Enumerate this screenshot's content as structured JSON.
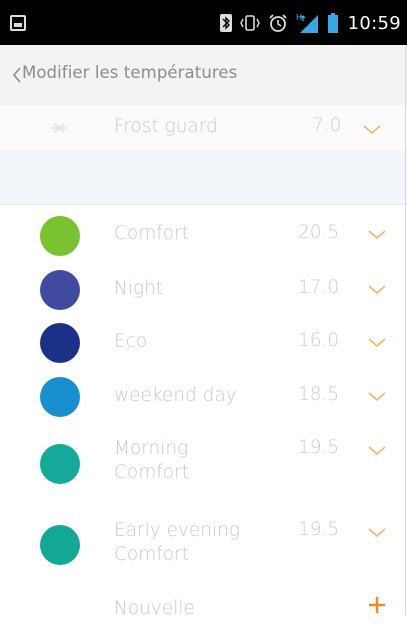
{
  "statusbar": {
    "time": "10:59",
    "icons": [
      "image-icon",
      "bluetooth-icon",
      "vibrate-icon",
      "alarm-icon",
      "signal-icon",
      "battery-icon"
    ]
  },
  "header": {
    "title": "Modifier les températures"
  },
  "frost": {
    "label": "Frost guard",
    "value": "7.0"
  },
  "items": [
    {
      "label": "Comfort",
      "value": "20.5",
      "color": "#7ac231"
    },
    {
      "label": "Night",
      "value": "17.0",
      "color": "#3f4aa0"
    },
    {
      "label": "Eco",
      "value": "16.0",
      "color": "#1d3087"
    },
    {
      "label": "weekend day",
      "value": "18.5",
      "color": "#1890d0"
    },
    {
      "label": "Morning\nComfort",
      "value": "19.5",
      "color": "#16a89a"
    },
    {
      "label": "Early evening\nComfort",
      "value": "19.5",
      "color": "#13a896"
    }
  ],
  "new_item": {
    "label": "Nouvelle",
    "icon": "plus-icon"
  },
  "colors": {
    "accent": "#f0a030",
    "text_muted": "#c9c9c9",
    "plus": "#f28a1e"
  }
}
